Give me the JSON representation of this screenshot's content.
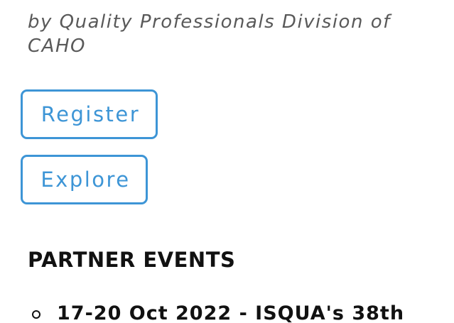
{
  "organizer": {
    "byline": "by Quality Professionals Division of CAHO"
  },
  "actions": {
    "register_label": "Register",
    "explore_label": "Explore"
  },
  "partner_events": {
    "heading": "PARTNER EVENTS",
    "items": [
      {
        "text": "17-20 Oct 2022 - ISQUA's 38th"
      }
    ]
  },
  "colors": {
    "accent": "#3d95d6",
    "text": "#111111",
    "byline": "#595959",
    "background": "#ffffff"
  },
  "icons": {
    "list_bullet": "hollow-circle-bullet-icon"
  }
}
